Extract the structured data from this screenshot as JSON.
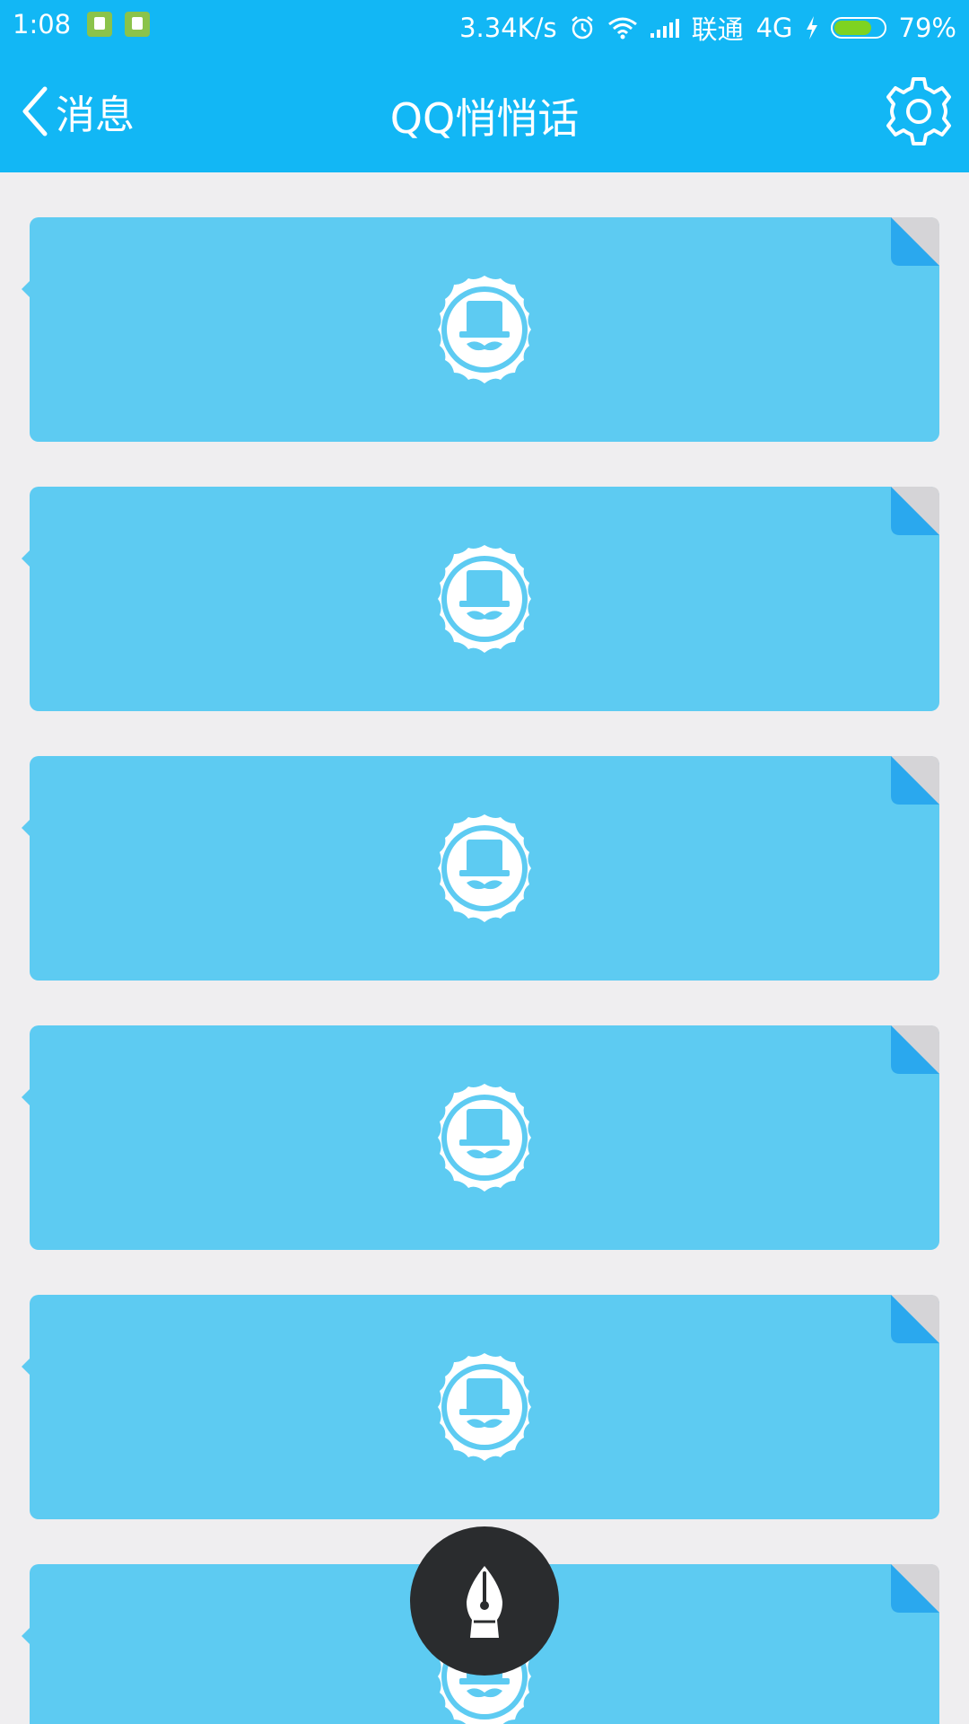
{
  "status_bar": {
    "time": "1:08",
    "network_speed": "3.34K/s",
    "carrier": "联通",
    "network_type": "4G",
    "battery_percent": "79%",
    "battery_level": 0.79,
    "icons": [
      "shield-app-icon",
      "sim-app-icon",
      "alarm-icon",
      "wifi-icon",
      "signal-icon",
      "charging-icon",
      "battery-icon"
    ]
  },
  "navbar": {
    "back_label": "消息",
    "title": "QQ悄悄话",
    "settings_icon": "gear-icon"
  },
  "colors": {
    "header": "#12B7F5",
    "background": "#EFEEF0",
    "card": "#5DCBF2",
    "fab": "#2A2C2E"
  },
  "messages": [
    {
      "icon": "anonymous-gentleman-icon"
    },
    {
      "icon": "anonymous-gentleman-icon"
    },
    {
      "icon": "anonymous-gentleman-icon"
    },
    {
      "icon": "anonymous-gentleman-icon"
    },
    {
      "icon": "anonymous-gentleman-icon"
    },
    {
      "icon": "anonymous-gentleman-icon"
    }
  ],
  "fab": {
    "icon": "pen-nib-icon"
  }
}
